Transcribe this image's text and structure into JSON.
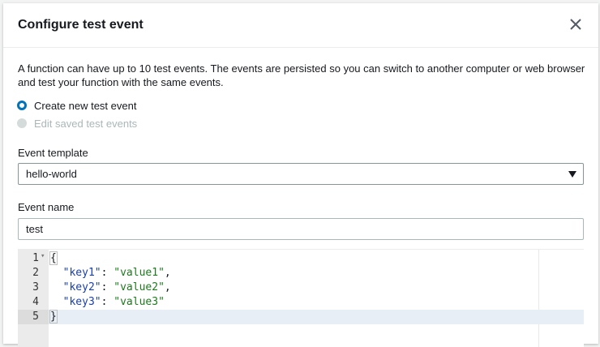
{
  "dialog": {
    "title": "Configure test event",
    "description": "A function can have up to 10 test events. The events are persisted so you can switch to another computer or web browser and test your function with the same events."
  },
  "options": {
    "create_new": "Create new test event",
    "edit_saved": "Edit saved test events"
  },
  "template": {
    "label": "Event template",
    "selected": "hello-world"
  },
  "event_name": {
    "label": "Event name",
    "value": "test"
  },
  "editor": {
    "lines": [
      {
        "num": "1",
        "text": "{"
      },
      {
        "num": "2",
        "key": "\"key1\"",
        "value": "\"value1\"",
        "sep": ": ",
        "tail": ","
      },
      {
        "num": "3",
        "key": "\"key2\"",
        "value": "\"value2\"",
        "sep": ": ",
        "tail": ","
      },
      {
        "num": "4",
        "key": "\"key3\"",
        "value": "\"value3\"",
        "sep": ": ",
        "tail": ""
      },
      {
        "num": "5",
        "text": "}"
      }
    ]
  },
  "colors": {
    "accent": "#0073bb",
    "json_key": "#1a3fa8",
    "json_string": "#1d7a1d"
  }
}
